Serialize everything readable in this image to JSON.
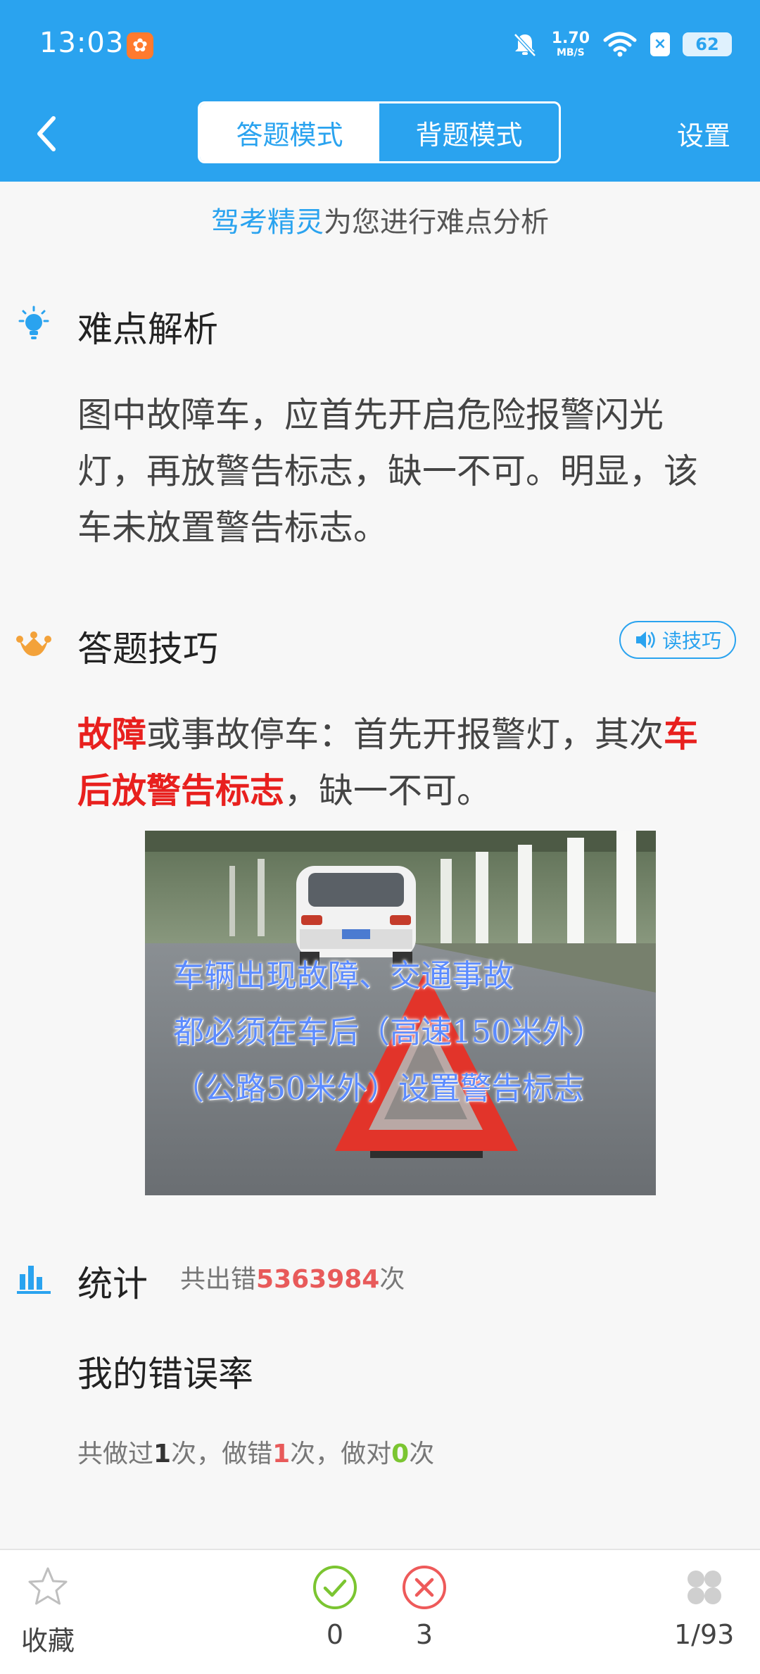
{
  "status_bar": {
    "time": "13:03",
    "net_speed_value": "1.70",
    "net_speed_unit": "MB/S",
    "battery": "62"
  },
  "header": {
    "tabs": [
      {
        "label": "答题模式",
        "active": true
      },
      {
        "label": "背题模式",
        "active": false
      }
    ],
    "settings_label": "设置"
  },
  "banner": {
    "brand": "驾考精灵",
    "text": "为您进行难点分析"
  },
  "difficulty": {
    "title": "难点解析",
    "text": "图中故障车，应首先开启危险报警闪光灯，再放警告标志，缺一不可。明显，该车未放置警告标志。"
  },
  "tips": {
    "title": "答题技巧",
    "read_button": "读技巧",
    "part1_red": "故障",
    "part2": "或事故停车：首先开报警灯，其次",
    "part3_red": "车后放警告标志",
    "part4": "，缺一不可。"
  },
  "illustration": {
    "line1": "车辆出现故障、交通事故",
    "line2": "都必须在车后（高速150米外）",
    "line3": "（公路50米外）设置警告标志"
  },
  "stats": {
    "title": "统计",
    "sub_prefix": "共出错",
    "sub_count": "5363984",
    "sub_suffix": "次",
    "my_rate_title": "我的错误率",
    "done_prefix": "共做过",
    "done_count": "1",
    "wrong_prefix": "次，做错",
    "wrong_count": "1",
    "right_prefix": "次，做对",
    "right_count": "0",
    "suffix": "次"
  },
  "bottom_bar": {
    "favorite_label": "收藏",
    "correct_count": "0",
    "wrong_count": "3",
    "progress": "1/93"
  },
  "colors": {
    "primary": "#2aa3ef",
    "red": "#e8201e",
    "error_red": "#e85a5a",
    "green": "#7bc531"
  }
}
